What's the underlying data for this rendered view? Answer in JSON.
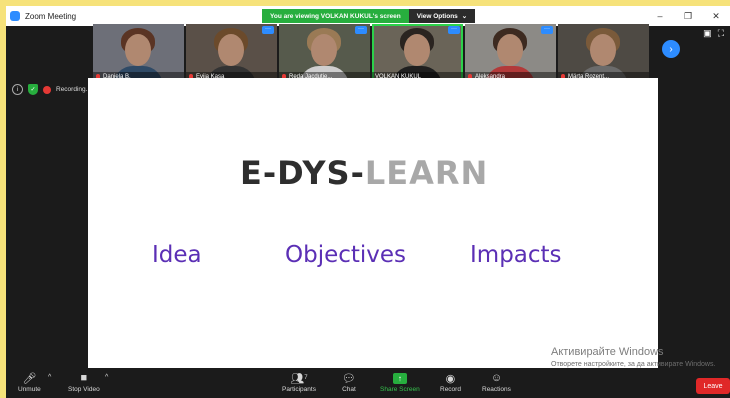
{
  "window": {
    "title": "Zoom Meeting",
    "controls": [
      "–",
      "❐",
      "✕"
    ]
  },
  "banner": {
    "viewing_text": "You are viewing VOLKAN KUKUL's screen",
    "view_options_label": "View Options",
    "view_options_caret": "⌄"
  },
  "participants_strip": [
    {
      "name": "Daniela B.",
      "hair": "#5a3424",
      "body": "#2f4a66",
      "bg": "#6d6f78",
      "muted": true,
      "menu": false
    },
    {
      "name": "Evija Kasa",
      "hair": "#6b4a2b",
      "body": "#333333",
      "bg": "#5a5048",
      "muted": true,
      "menu": true
    },
    {
      "name": "Reda Jacdutie...",
      "hair": "#9a7a55",
      "body": "#cfcfcf",
      "bg": "#565a4c",
      "muted": true,
      "menu": true
    },
    {
      "name": "VOLKAN KUKUL",
      "hair": "#2a2420",
      "body": "#1f1f1f",
      "bg": "#6a6458",
      "muted": false,
      "menu": true,
      "active": true
    },
    {
      "name": "Aleksandra",
      "hair": "#3d2a20",
      "body": "#b23a3a",
      "bg": "#8c8a86",
      "muted": true,
      "menu": true
    },
    {
      "name": "Märta Rozent...",
      "hair": "#7a5a3a",
      "body": "#6b6b6b",
      "bg": "#4e4a44",
      "muted": true,
      "menu": false
    }
  ],
  "status": {
    "recording_label": "Recording...",
    "info_icon": "i",
    "shield_icon": "✓"
  },
  "slide": {
    "title_dark": "E-DYS-",
    "title_light": "LEARN",
    "words": [
      "Idea",
      "Objectives",
      "Impacts"
    ]
  },
  "watermark": {
    "title": "Активирайте Windows",
    "subtitle": "Отворете настройките, за да активирате Windows."
  },
  "toolbar": {
    "unmute": "Unmute",
    "stop_video": "Stop Video",
    "participants": "Participants",
    "participants_count": "7",
    "chat": "Chat",
    "share_screen": "Share Screen",
    "record": "Record",
    "reactions": "Reactions",
    "leave": "Leave"
  },
  "colors": {
    "accent_blue": "#2d8cff",
    "share_green": "#27ae3e",
    "slide_purple": "#5b2fb5",
    "leave_red": "#e02828"
  }
}
